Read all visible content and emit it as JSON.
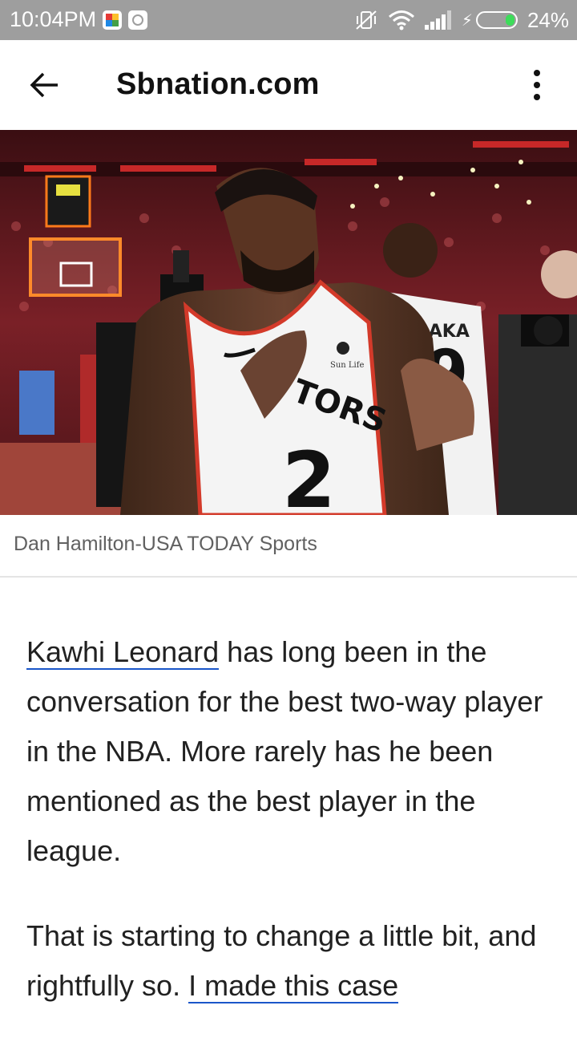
{
  "status_bar": {
    "time": "10:04PM",
    "battery_percent": "24%",
    "battery_level": 0.24,
    "icons": [
      "photos-notification-icon",
      "game-notification-icon",
      "vibrate-off-icon",
      "wifi-icon",
      "signal-icon",
      "charging-icon",
      "battery-icon"
    ]
  },
  "app_bar": {
    "title": "Sbnation.com",
    "back_icon": "arrow-left-icon",
    "menu_icon": "more-vertical-icon"
  },
  "hero_image": {
    "description_icon": "basketball-photo",
    "jersey_number": "2",
    "credit": "Dan Hamilton-USA TODAY Sports"
  },
  "article": {
    "p1_link": "Kawhi Leonard",
    "p1_text": " has long been in the conversation for the best two-way player in the NBA. More rarely has he been mentioned as the best player in the league.",
    "p2_text": "That is starting to change a little bit, and rightfully so. ",
    "p2_link": "I made this case"
  },
  "colors": {
    "status_bar_bg": "#9e9e9e",
    "link_underline": "#1a56c9",
    "text": "#212121"
  }
}
